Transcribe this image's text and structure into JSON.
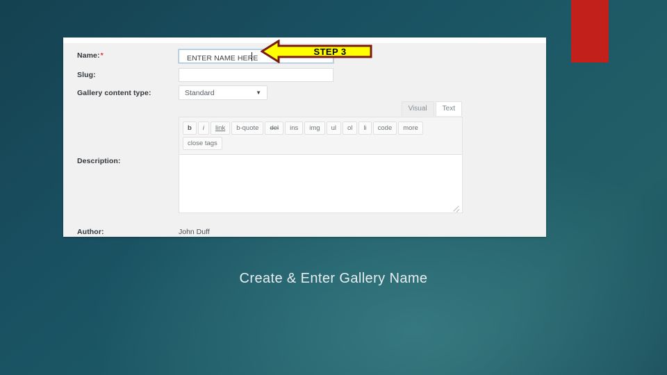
{
  "slide": {
    "caption": "Create & Enter Gallery Name",
    "background_color": "#1d5460",
    "accent_color": "#c1201b"
  },
  "callout": {
    "label": "STEP 3",
    "fill_color": "#ffff00",
    "border_color": "#7b1a10",
    "text_color": "#000000",
    "direction": "left"
  },
  "form": {
    "fields": [
      {
        "label": "Name:",
        "required": true,
        "value": "ENTER NAME HERE",
        "type": "text",
        "focused": true
      },
      {
        "label": "Slug:",
        "required": false,
        "value": "",
        "type": "text",
        "focused": false
      },
      {
        "label": "Gallery content type:",
        "required": false,
        "value": "Standard",
        "type": "select"
      },
      {
        "label": "Description:",
        "required": false,
        "value": "",
        "type": "editor"
      },
      {
        "label": "Author:",
        "required": false,
        "value": "John Duff",
        "type": "readonly"
      }
    ],
    "required_marker": "*"
  },
  "editor": {
    "tabs": [
      {
        "label": "Visual",
        "active": false
      },
      {
        "label": "Text",
        "active": true
      }
    ],
    "toolbar_buttons": [
      {
        "label": "b",
        "style": "bold"
      },
      {
        "label": "i",
        "style": "italic"
      },
      {
        "label": "link",
        "style": "underline"
      },
      {
        "label": "b-quote",
        "style": "plain"
      },
      {
        "label": "del",
        "style": "strike"
      },
      {
        "label": "ins",
        "style": "plain"
      },
      {
        "label": "img",
        "style": "plain"
      },
      {
        "label": "ul",
        "style": "plain"
      },
      {
        "label": "ol",
        "style": "plain"
      },
      {
        "label": "li",
        "style": "plain"
      },
      {
        "label": "code",
        "style": "plain"
      },
      {
        "label": "more",
        "style": "plain"
      },
      {
        "label": "close tags",
        "style": "plain"
      }
    ],
    "content": ""
  }
}
